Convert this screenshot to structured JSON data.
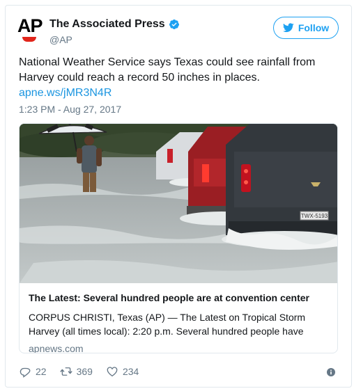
{
  "author": {
    "name": "The Associated Press",
    "handle": "@AP",
    "avatar_text": "AP"
  },
  "follow_label": "Follow",
  "tweet": {
    "text": "National Weather Service says Texas could see rainfall from Harvey could reach a record 50 inches in places.",
    "link": "apne.ws/jMR3N4R",
    "timestamp": "1:23 PM - Aug 27, 2017"
  },
  "card": {
    "title": "The Latest: Several hundred people are at convention center",
    "description": "CORPUS CHRISTI, Texas (AP) — The Latest on Tropical Storm Harvey (all times local): 2:20 p.m. Several hundred people have",
    "domain": "apnews.com",
    "plate_text": "TWX-5193"
  },
  "stats": {
    "replies": "22",
    "retweets": "369",
    "likes": "234"
  },
  "icons": {
    "verified": "verified-badge-icon",
    "follow": "twitter-bird-icon",
    "reply": "reply-icon",
    "retweet": "retweet-icon",
    "like": "heart-icon",
    "info": "info-icon"
  },
  "colors": {
    "accent": "#1da1f2",
    "link": "#1b95e0",
    "muted": "#657786",
    "ap_red": "#e1251b"
  }
}
